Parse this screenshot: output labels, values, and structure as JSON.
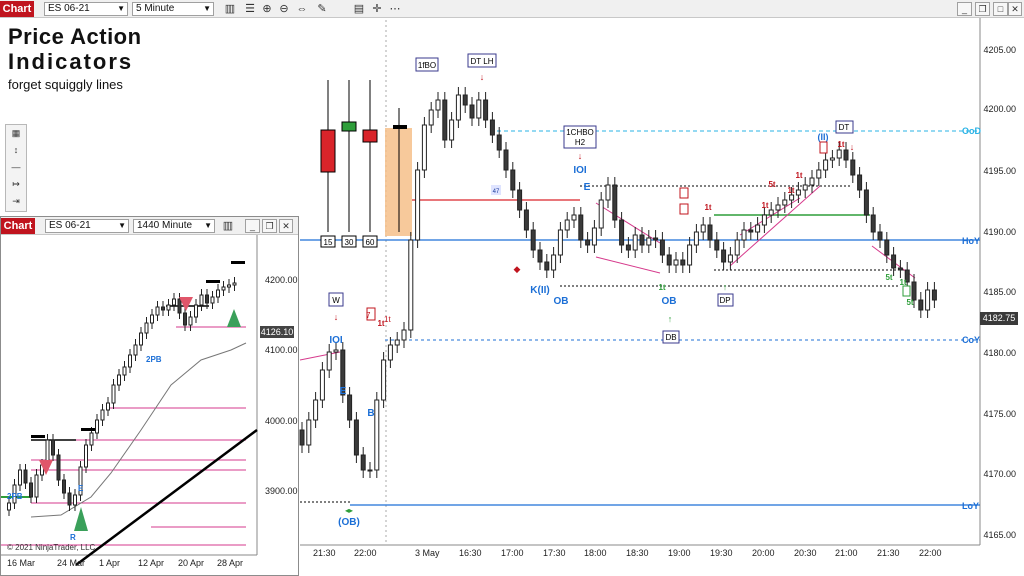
{
  "main": {
    "tab": "Chart",
    "instrument": "ES 06-21",
    "interval": "5 Minute",
    "title_line1": "Price Action",
    "title_line2": "Indicators",
    "subtitle": "forget squiggly lines",
    "price_levels": [
      "4205.00",
      "4200.00",
      "4195.00",
      "4190.00",
      "4185.00",
      "4180.00",
      "4175.00",
      "4170.00",
      "4165.00"
    ],
    "last_price": "4182.75",
    "ref_lines": [
      "OoD",
      "HoY",
      "CoY",
      "LoY"
    ],
    "time_labels": [
      "21:30",
      "22:00",
      "3 May",
      "16:30",
      "17:00",
      "17:30",
      "18:00",
      "18:30",
      "19:00",
      "19:30",
      "20:00",
      "20:30",
      "21:00",
      "21:30",
      "22:00"
    ],
    "timeframe_boxes": [
      "15",
      "30",
      "60"
    ],
    "annotations": {
      "fbo": "1fBO",
      "dt_lh": "DT LH",
      "chbo_1": "1CHBO",
      "chbo_2": "H2",
      "ioi_1": "IOI",
      "ioi_2": "IOI",
      "w": "W",
      "seven": "7",
      "one_t_1": "1t",
      "e_1": "E",
      "e_2": "E",
      "b": "B",
      "ob_bottom": "(OB)",
      "k2": "K(II)",
      "ob_1": "OB",
      "ob_2": "OB",
      "db": "DB",
      "dp": "DP",
      "t_1": "1t",
      "t_2": "1t",
      "st_1": "5t",
      "t_3": "1t",
      "t_4": "1t",
      "t_5": "1t",
      "ii": "(II)",
      "dt": "DT",
      "t_6": "1t",
      "st_2": "5t",
      "t_7": "1t",
      "st_3": "5t",
      "t_8": "1t",
      "num_47": "47"
    }
  },
  "inset": {
    "tab": "Chart",
    "instrument": "ES 06-21",
    "interval": "1440 Minute",
    "price_levels": [
      "4200.00",
      "4100.00",
      "4000.00",
      "3900.00"
    ],
    "last_price": "4126.10",
    "time_labels": [
      "16 Mar",
      "24 Mar",
      "1 Apr",
      "12 Apr",
      "20 Apr",
      "28 Apr"
    ],
    "labels": {
      "pb_1": "2PB",
      "pb_2": "2PB",
      "e": "E",
      "r": "R"
    },
    "copyright": "© 2021 NinjaTrader, LLC"
  },
  "colors": {
    "bull": "#2e9e3a",
    "bear": "#d9242a",
    "level_blue": "#1c6fd6",
    "ood": "#2ab3e6",
    "orange_box": "#f6c08a",
    "magenta": "#d63a8c"
  },
  "icons": [
    "bar-chart-icon",
    "instrument-icon",
    "zoom-in-icon",
    "zoom-out-icon",
    "arrows-icon",
    "pencil-icon",
    "properties-icon",
    "crosshair-icon",
    "more-icon"
  ]
}
